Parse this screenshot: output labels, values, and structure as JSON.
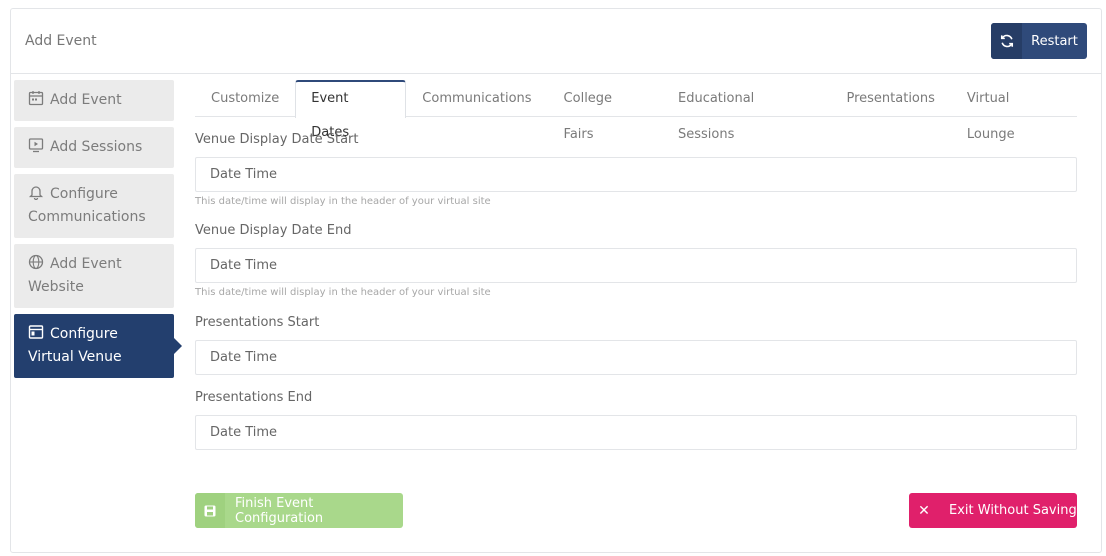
{
  "header": {
    "title": "Add Event",
    "restart_label": "Restart",
    "restart_icon": "refresh-icon"
  },
  "sidebar": {
    "items": [
      {
        "label": "Add Event",
        "icon": "calendar-icon",
        "active": false
      },
      {
        "label": "Add Sessions",
        "icon": "play-screen-icon",
        "active": false
      },
      {
        "label": "Configure Communications",
        "icon": "bell-icon",
        "active": false
      },
      {
        "label": "Add Event Website",
        "icon": "globe-icon",
        "active": false
      },
      {
        "label": "Configure Virtual Venue",
        "icon": "window-icon",
        "active": true
      }
    ]
  },
  "tabs": [
    {
      "label": "Customize",
      "active": false
    },
    {
      "label": "Event Dates",
      "active": true
    },
    {
      "label": "Communications",
      "active": false
    },
    {
      "label": "College Fairs",
      "active": false
    },
    {
      "label": "Educational Sessions",
      "active": false
    },
    {
      "label": "Presentations",
      "active": false
    },
    {
      "label": "Virtual Lounge",
      "active": false
    }
  ],
  "form": {
    "fields": [
      {
        "label": "Venue Display Date Start",
        "placeholder": "Date Time",
        "help": "This date/time will display in the header of your virtual site"
      },
      {
        "label": "Venue Display Date End",
        "placeholder": "Date Time",
        "help": "This date/time will display in the header of your virtual site"
      },
      {
        "label": "Presentations Start",
        "placeholder": "Date Time",
        "help": ""
      },
      {
        "label": "Presentations End",
        "placeholder": "Date Time",
        "help": ""
      }
    ]
  },
  "actions": {
    "finish_label": "Finish Event Configuration",
    "finish_icon": "save-icon",
    "exit_label": "Exit Without Saving",
    "exit_icon": "close-icon"
  },
  "colors": {
    "primary": "#2f4a7a",
    "sidebar_active": "#233f6e",
    "finish": "#a9d88b",
    "exit": "#e0206b"
  }
}
